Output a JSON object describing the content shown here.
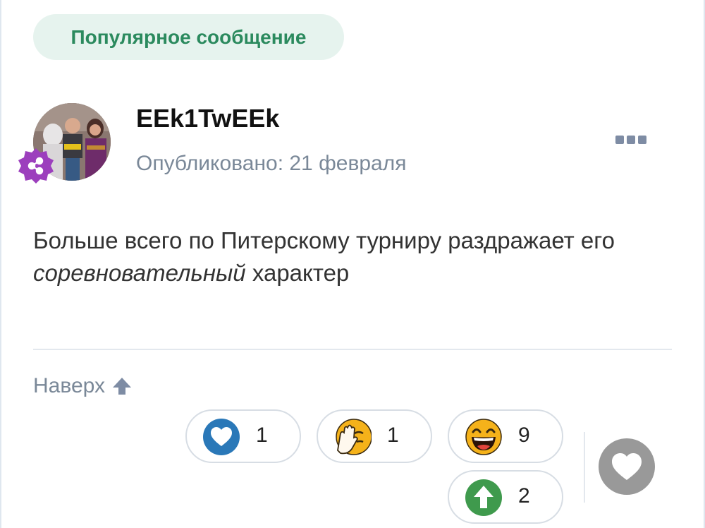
{
  "badge": {
    "label": "Популярное сообщение"
  },
  "post": {
    "username": "EEk1TwEEk",
    "published": "Опубликовано: 21 февраля",
    "body_pre": "Больше всего по Питерскому турниру раздражает его ",
    "body_em": "соревновательный",
    "body_post": " характер"
  },
  "footer": {
    "top_link": "Наверх"
  },
  "reactions": [
    {
      "name": "heart",
      "count": "1"
    },
    {
      "name": "facepalm",
      "count": "1"
    },
    {
      "name": "laughing",
      "count": "9"
    },
    {
      "name": "upvote",
      "count": "2"
    }
  ],
  "colors": {
    "badge_bg": "#e6f3ee",
    "badge_text": "#2b8a5e",
    "muted_text": "#7a8898",
    "group_badge": "#9c3fbd",
    "like_button": "#999999"
  },
  "icons": [
    "share-icon",
    "more-icon",
    "arrow-up-icon",
    "heart-icon",
    "facepalm-emoji-icon",
    "laughing-emoji-icon",
    "upvote-icon"
  ]
}
